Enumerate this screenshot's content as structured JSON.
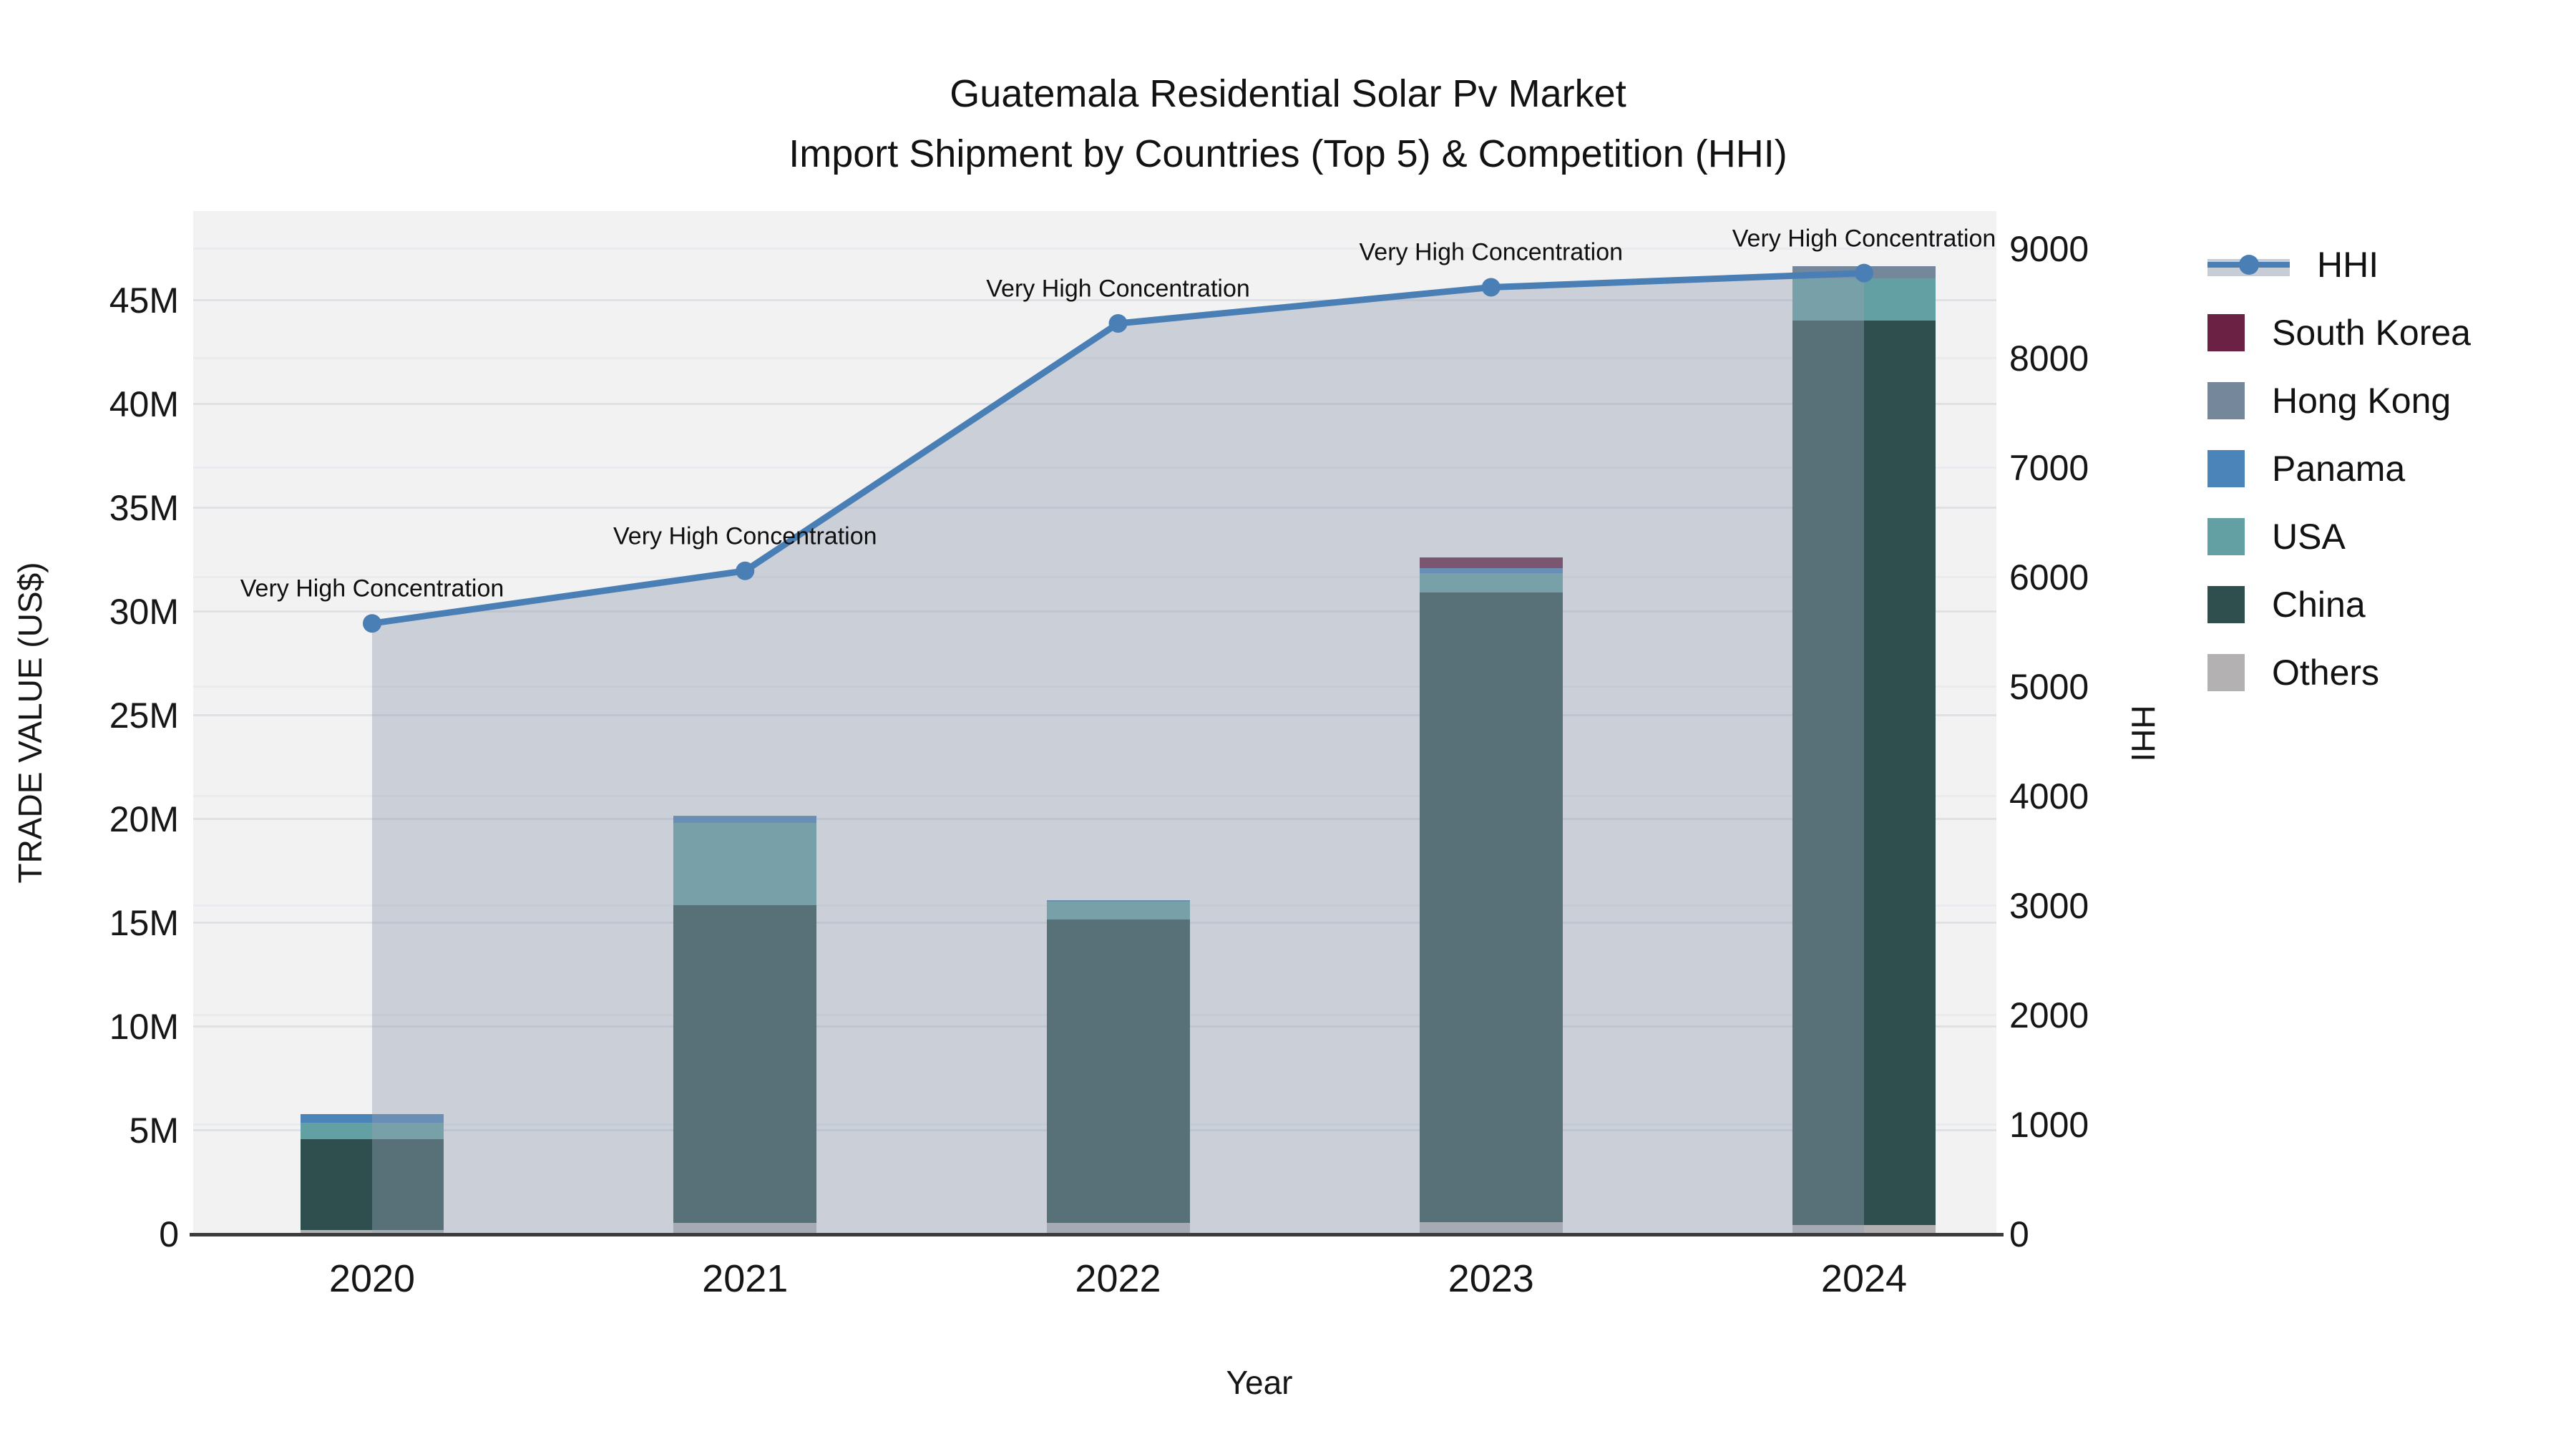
{
  "title": {
    "line1": "Guatemala Residential Solar Pv Market",
    "line2": "Import Shipment by Countries (Top 5) & Competition (HHI)"
  },
  "colors": {
    "hhi_line": "#4a7fb5",
    "hhi_fill": "rgba(148,160,178,0.42)",
    "south_korea": "#6b2143",
    "hong_kong": "#75879a",
    "panama": "#4a84b8",
    "usa": "#63a0a3",
    "china": "#2e4f4e",
    "others": "#b3b1b1",
    "plot_bg": "#f2f2f3",
    "axis_line": "#3b3b3b"
  },
  "legend": {
    "items": [
      {
        "label": "HHI",
        "type": "line",
        "color_key": "hhi_line"
      },
      {
        "label": "South Korea",
        "type": "square",
        "color_key": "south_korea"
      },
      {
        "label": "Hong Kong",
        "type": "square",
        "color_key": "hong_kong"
      },
      {
        "label": "Panama",
        "type": "square",
        "color_key": "panama"
      },
      {
        "label": "USA",
        "type": "square",
        "color_key": "usa"
      },
      {
        "label": "China",
        "type": "square",
        "color_key": "china"
      },
      {
        "label": "Others",
        "type": "square",
        "color_key": "others"
      }
    ]
  },
  "chart_data": {
    "type": "bar",
    "subtype": "stacked-bars-with-line-area",
    "categories": [
      "2020",
      "2021",
      "2022",
      "2023",
      "2024"
    ],
    "bar_series": [
      {
        "name": "Others",
        "color_key": "others",
        "values": [
          210000,
          550000,
          550000,
          590000,
          450000
        ]
      },
      {
        "name": "China",
        "color_key": "china",
        "values": [
          4380000,
          15310000,
          14620000,
          30350000,
          43570000
        ]
      },
      {
        "name": "USA",
        "color_key": "usa",
        "values": [
          790000,
          3970000,
          860000,
          900000,
          2040000
        ]
      },
      {
        "name": "Panama",
        "color_key": "panama",
        "values": [
          410000,
          300000,
          70000,
          240000,
          0
        ]
      },
      {
        "name": "Hong Kong",
        "color_key": "hong_kong",
        "values": [
          0,
          50000,
          0,
          0,
          590000
        ]
      },
      {
        "name": "South Korea",
        "color_key": "south_korea",
        "values": [
          0,
          0,
          0,
          550000,
          0
        ]
      }
    ],
    "line_series": {
      "name": "HHI",
      "values": [
        5580,
        6060,
        8320,
        8650,
        8780
      ],
      "fill_to_zero": true,
      "axis": "right"
    },
    "annotations": [
      "Very High Concentration",
      "Very High Concentration",
      "Very High Concentration",
      "Very High Concentration",
      "Very High Concentration"
    ],
    "left_axis": {
      "title": "TRADE VALUE (US$)",
      "ticks": [
        {
          "value": 0,
          "label": "0"
        },
        {
          "value": 5000000,
          "label": "5M"
        },
        {
          "value": 10000000,
          "label": "10M"
        },
        {
          "value": 15000000,
          "label": "15M"
        },
        {
          "value": 20000000,
          "label": "20M"
        },
        {
          "value": 25000000,
          "label": "25M"
        },
        {
          "value": 30000000,
          "label": "30M"
        },
        {
          "value": 35000000,
          "label": "35M"
        },
        {
          "value": 40000000,
          "label": "40M"
        },
        {
          "value": 45000000,
          "label": "45M"
        }
      ],
      "range": [
        0,
        49300000
      ]
    },
    "right_axis": {
      "title": "HHI",
      "ticks": [
        {
          "value": 0,
          "label": "0"
        },
        {
          "value": 1000,
          "label": "1000"
        },
        {
          "value": 2000,
          "label": "2000"
        },
        {
          "value": 3000,
          "label": "3000"
        },
        {
          "value": 4000,
          "label": "4000"
        },
        {
          "value": 5000,
          "label": "5000"
        },
        {
          "value": 6000,
          "label": "6000"
        },
        {
          "value": 7000,
          "label": "7000"
        },
        {
          "value": 8000,
          "label": "8000"
        },
        {
          "value": 9000,
          "label": "9000"
        }
      ],
      "range": [
        0,
        9346
      ]
    },
    "x_axis": {
      "title": "Year"
    },
    "grid": true,
    "legend_position": "right"
  }
}
